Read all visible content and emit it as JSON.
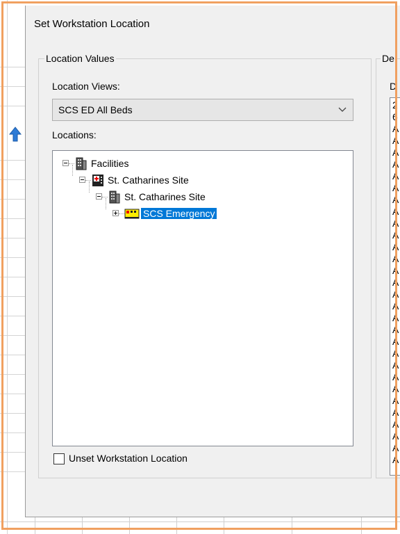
{
  "dialog": {
    "title": "Set Workstation Location"
  },
  "location_values": {
    "legend": "Location Values",
    "views_label": "Location Views:",
    "views_selected": "SCS ED All Beds",
    "locations_label": "Locations:",
    "tree": [
      {
        "label": "Facilities",
        "icon": "building-icon",
        "level": 0,
        "expander": "minus"
      },
      {
        "label": "St. Catharines Site",
        "icon": "hospital-icon",
        "level": 1,
        "expander": "minus"
      },
      {
        "label": "St. Catharines Site",
        "icon": "building-icon",
        "level": 2,
        "expander": "minus"
      },
      {
        "label": "SCS Emergency",
        "icon": "emergency-unit-icon",
        "level": 3,
        "expander": "plus",
        "selected": true
      }
    ],
    "unset_label": "Unset Workstation Location",
    "unset_checked": false
  },
  "right_group": {
    "legend_partial": "De",
    "label_partial": "D",
    "items": [
      "2",
      "6",
      "A",
      "A",
      "A",
      "A",
      "A",
      "A",
      "A",
      "A",
      "A",
      "A",
      "A",
      "A",
      "A",
      "A",
      "A",
      "A",
      "A",
      "A",
      "A",
      "A",
      "A",
      "A",
      "A",
      "A",
      "A",
      "A",
      "A",
      "A",
      "A"
    ]
  },
  "colors": {
    "selection": "#0078d7",
    "dialog_bg": "#f0f0f0",
    "highlight_frame": "#f0a060"
  }
}
